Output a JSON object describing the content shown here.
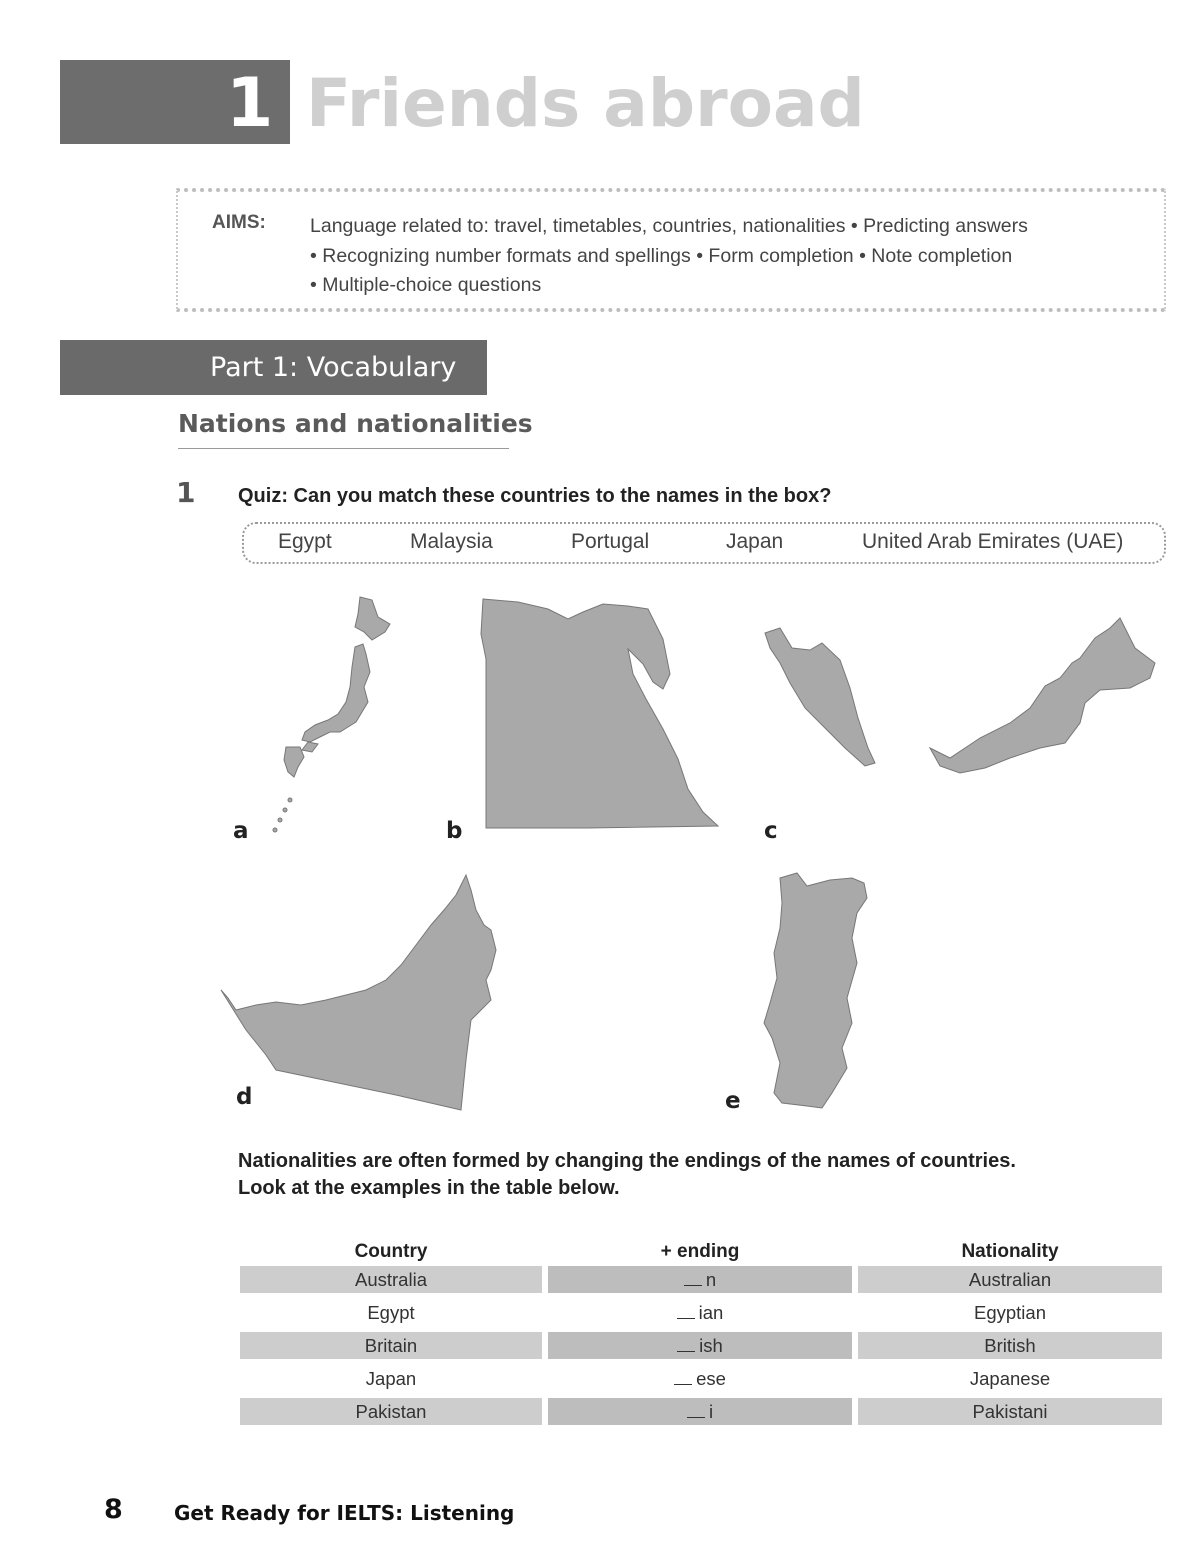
{
  "unit": {
    "number": "1",
    "title": "Friends abroad"
  },
  "aims": {
    "label": "AIMS:",
    "lines": [
      "Language related to: travel, timetables, countries, nationalities • Predicting answers",
      "• Recognizing number formats and spellings • Form completion • Note completion",
      "• Multiple-choice questions"
    ]
  },
  "part": {
    "title": "Part 1: Vocabulary"
  },
  "section": {
    "heading": "Nations and nationalities"
  },
  "exercise1": {
    "number": "1",
    "instruction": "Quiz: Can you match these countries to the names in the box?",
    "word_box": [
      "Egypt",
      "Malaysia",
      "Portugal",
      "Japan",
      "United Arab Emirates (UAE)"
    ],
    "maps": [
      {
        "label": "a",
        "depicts": "Japan"
      },
      {
        "label": "b",
        "depicts": "Egypt"
      },
      {
        "label": "c",
        "depicts": "Malaysia"
      },
      {
        "label": "d",
        "depicts": "United Arab Emirates"
      },
      {
        "label": "e",
        "depicts": "Portugal"
      }
    ],
    "map_fill_color": "#a9a9a9"
  },
  "intro": {
    "line1": "Nationalities are often formed by changing the endings of the names of countries.",
    "line2": "Look at the examples in the table below."
  },
  "table": {
    "headers": [
      "Country",
      "+ ending",
      "Nationality"
    ],
    "rows": [
      {
        "country": "Australia",
        "ending": "n",
        "nationality": "Australian"
      },
      {
        "country": "Egypt",
        "ending": "ian",
        "nationality": "Egyptian"
      },
      {
        "country": "Britain",
        "ending": "ish",
        "nationality": "British"
      },
      {
        "country": "Japan",
        "ending": "ese",
        "nationality": "Japanese"
      },
      {
        "country": "Pakistan",
        "ending": "i",
        "nationality": "Pakistani"
      }
    ]
  },
  "footer": {
    "page_number": "8",
    "book_title": "Get Ready for IELTS: Listening"
  }
}
